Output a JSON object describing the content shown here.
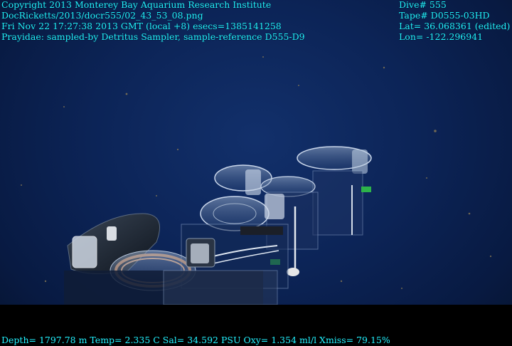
{
  "overlay": {
    "top_left": [
      "Copyright 2013 Monterey Bay Aquarium Research Institute",
      "DocRicketts/2013/docr555/02_43_53_08.png",
      "Fri Nov 22 17:27:38 2013 GMT (local +8)  esecs=1385141258",
      "Prayidae: sampled-by Detritus Sampler, sample-reference D555-D9"
    ],
    "top_right": [
      "Dive# 555",
      "Tape# D0555-03HD",
      "Lat= 36.068361 (edited)",
      "Lon= -122.296941"
    ],
    "bottom": "Depth= 1797.78 m  Temp= 2.335 C  Sal= 34.592 PSU  Oxy= 1.354 ml/l  Xmiss= 79.15%"
  },
  "colors": {
    "overlay_text": "#22f2ff",
    "water": "#0c2457",
    "letterbox": "#000000"
  }
}
